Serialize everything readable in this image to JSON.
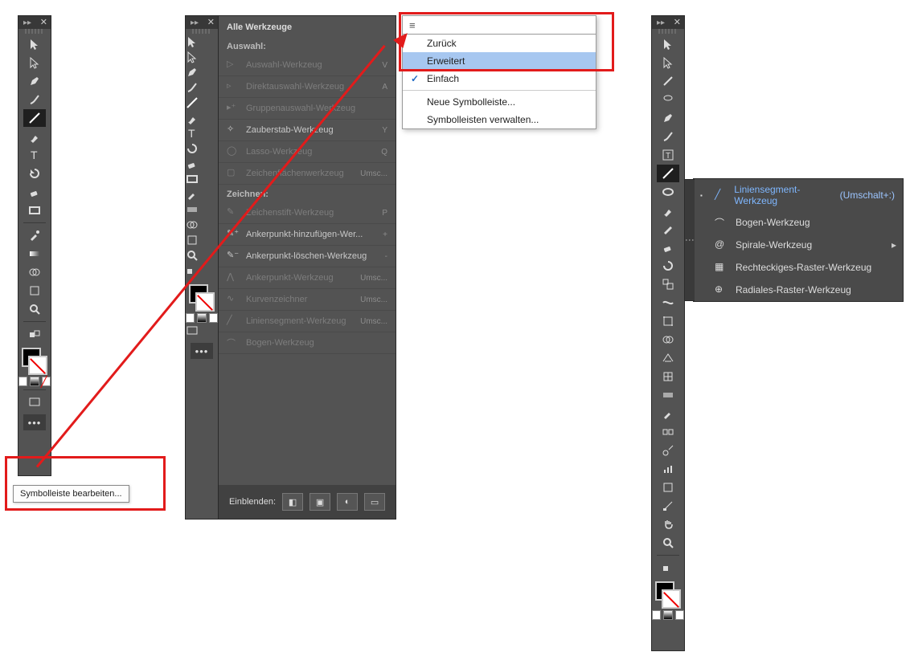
{
  "tooltip": {
    "text": "Symbolleiste bearbeiten..."
  },
  "menu": {
    "items": [
      {
        "label": "Zurück"
      },
      {
        "label": "Erweitert"
      },
      {
        "label": "Einfach"
      },
      {
        "label": "Neue Symbolleiste..."
      },
      {
        "label": "Symbolleisten verwalten..."
      }
    ]
  },
  "list": {
    "title": "Alle Werkzeuge",
    "section_auswahl": "Auswahl:",
    "section_zeichnen": "Zeichnen:",
    "rows": [
      {
        "label": "Auswahl-Werkzeug",
        "shortcut": "V"
      },
      {
        "label": "Direktauswahl-Werkzeug",
        "shortcut": "A"
      },
      {
        "label": "Gruppenauswahl-Werkzeug",
        "shortcut": ""
      },
      {
        "label": "Zauberstab-Werkzeug",
        "shortcut": "Y"
      },
      {
        "label": "Lasso-Werkzeug",
        "shortcut": "Q"
      },
      {
        "label": "Zeichenflächenwerkzeug",
        "shortcut": "Umsc..."
      },
      {
        "label": "Zeichenstift-Werkzeug",
        "shortcut": "P"
      },
      {
        "label": "Ankerpunkt-hinzufügen-Wer...",
        "shortcut": "+"
      },
      {
        "label": "Ankerpunkt-löschen-Werkzeug",
        "shortcut": "-"
      },
      {
        "label": "Ankerpunkt-Werkzeug",
        "shortcut": "Umsc..."
      },
      {
        "label": "Kurvenzeichner",
        "shortcut": "Umsc..."
      },
      {
        "label": "Liniensegment-Werkzeug",
        "shortcut": "Umsc..."
      },
      {
        "label": "Bogen-Werkzeug",
        "shortcut": ""
      }
    ],
    "footer_label": "Einblenden:"
  },
  "flyout": {
    "items": [
      {
        "label": "Liniensegment-Werkzeug",
        "shortcut": "(Umschalt+:)"
      },
      {
        "label": "Bogen-Werkzeug"
      },
      {
        "label": "Spirale-Werkzeug"
      },
      {
        "label": "Rechteckiges-Raster-Werkzeug"
      },
      {
        "label": "Radiales-Raster-Werkzeug"
      }
    ]
  }
}
